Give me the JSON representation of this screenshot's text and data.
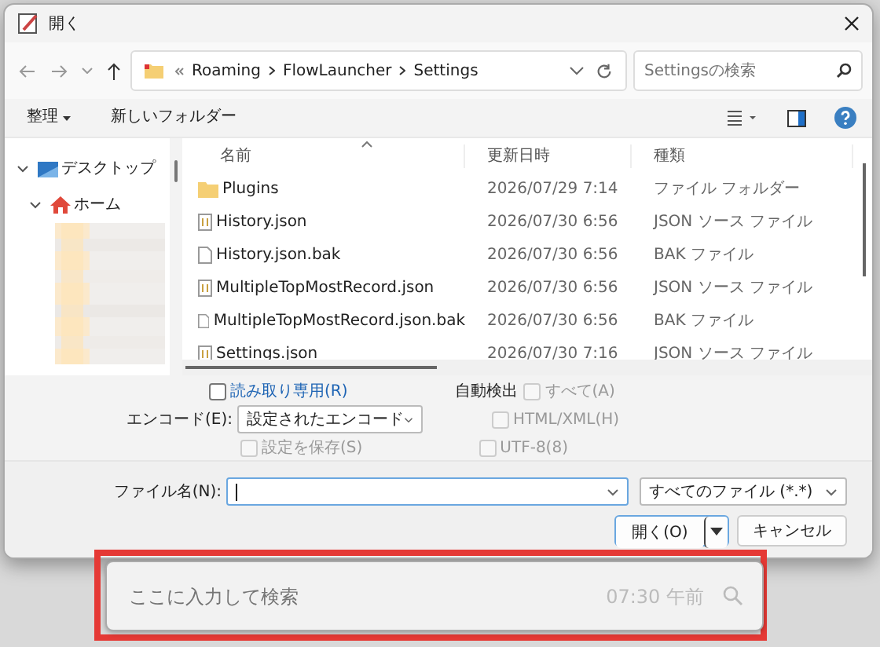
{
  "window": {
    "title": "開く"
  },
  "address": {
    "path": [
      "Roaming",
      "FlowLauncher",
      "Settings"
    ],
    "search_placeholder": "Settingsの検索"
  },
  "toolbar": {
    "organize": "整理",
    "new_folder": "新しいフォルダー"
  },
  "sidebar": {
    "items": [
      {
        "label": "デスクトップ",
        "kind": "desktop",
        "expanded": true,
        "children": [
          {
            "label": "ホーム",
            "kind": "home",
            "expanded": true
          }
        ]
      }
    ]
  },
  "table": {
    "columns": [
      {
        "label": "名前",
        "sorted": true
      },
      {
        "label": "更新日時",
        "sorted": false
      },
      {
        "label": "種類",
        "sorted": false
      }
    ],
    "rows": [
      {
        "kind": "folder",
        "name": "Plugins",
        "modified": "2026/07/29 7:14",
        "type": "ファイル フォルダー"
      },
      {
        "kind": "json",
        "name": "History.json",
        "modified": "2026/07/30 6:56",
        "type": "JSON ソース ファイル"
      },
      {
        "kind": "file",
        "name": "History.json.bak",
        "modified": "2026/07/30 6:56",
        "type": "BAK ファイル"
      },
      {
        "kind": "json",
        "name": "MultipleTopMostRecord.json",
        "modified": "2026/07/30 6:56",
        "type": "JSON ソース ファイル"
      },
      {
        "kind": "file",
        "name": "MultipleTopMostRecord.json.bak",
        "modified": "2026/07/30 6:56",
        "type": "BAK ファイル"
      },
      {
        "kind": "json",
        "name": "Settings.json",
        "modified": "2026/07/30 7:16",
        "type": "JSON ソース ファイル"
      }
    ]
  },
  "options": {
    "read_only": {
      "label": "読み取り専用(R)",
      "checked": false
    },
    "encoding": {
      "label": "エンコード(E):",
      "value": "設定されたエンコード"
    },
    "save_setting": {
      "label": "設定を保存(S)",
      "checked": false,
      "disabled": true
    },
    "auto_detect": {
      "label": "自動検出",
      "checkboxes": [
        {
          "label": "すべて(A)",
          "checked": false,
          "disabled": true
        },
        {
          "label": "HTML/XML(H)",
          "checked": false,
          "disabled": true
        },
        {
          "label": "UTF-8(8)",
          "checked": false,
          "disabled": true
        }
      ]
    }
  },
  "file_name": {
    "label": "ファイル名(N):"
  },
  "file_type": {
    "value": "すべてのファイル (*.*)"
  },
  "buttons": {
    "open": "開く(O)",
    "cancel": "キャンセル"
  },
  "launcher": {
    "placeholder": "ここに入力して検索",
    "time": "07:30 午前"
  }
}
